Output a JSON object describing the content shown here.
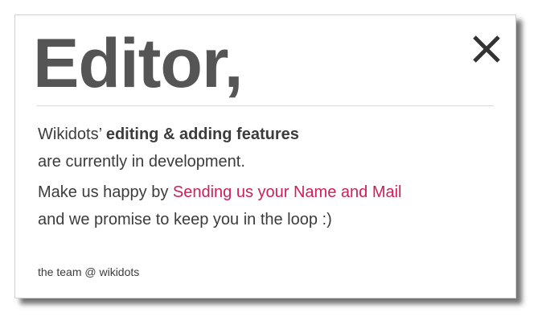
{
  "dialog": {
    "title": "Editor,",
    "close_icon": "close-x-icon",
    "message": {
      "line1_prefix": "Wikidots’",
      "line1_bold": "editing & adding features",
      "line2": "are currently in development.",
      "line3_prefix": "Make us happy by",
      "line3_link": "Sending us your Name and Mail",
      "line4": "and we promise to keep you in the loop :)"
    },
    "signature": "the team @ wikidots"
  },
  "colors": {
    "title": "#555555",
    "text": "#3c3c3c",
    "link": "#cc1f5c",
    "close_icon": "#333333"
  }
}
